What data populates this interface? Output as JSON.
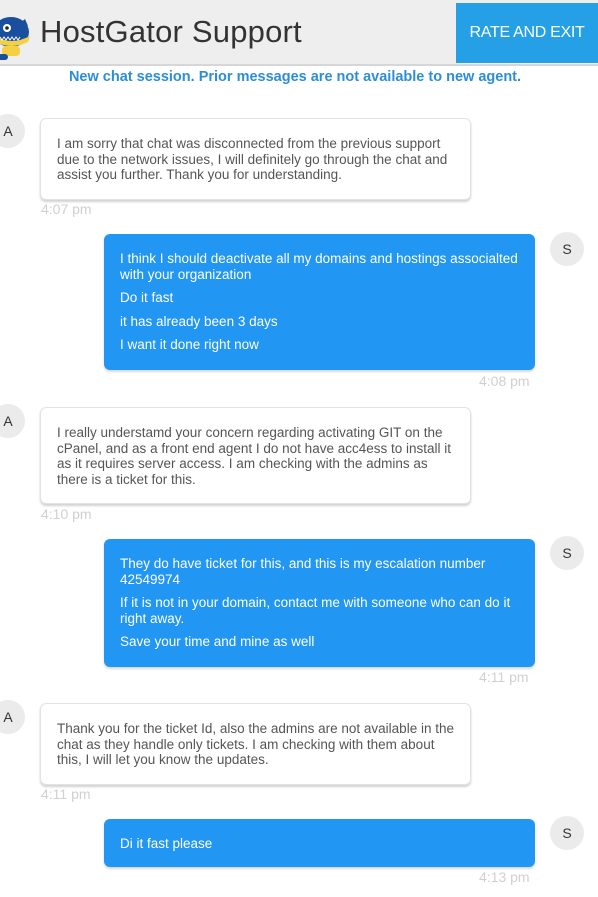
{
  "header": {
    "title": "HostGator Support",
    "rate_exit_label": "RATE AND EXIT"
  },
  "notice": "New chat session. Prior messages are not available to new agent.",
  "colors": {
    "header_bg": "#eeeeee",
    "button_bg": "#25a0e6",
    "notice_text": "#2d8ed6",
    "user_bubble": "#2196f3",
    "agent_bubble": "#ffffff",
    "timestamp": "#d0d0d0"
  },
  "messages": [
    {
      "sender": "agent",
      "avatar": "A",
      "lines": [
        "I am sorry that chat was disconnected from the previous support due to the network issues, I will definitely go through the chat and assist you further. Thank you for understanding."
      ],
      "time": "4:07 pm"
    },
    {
      "sender": "user",
      "avatar": "S",
      "lines": [
        "I think I should deactivate all my domains and hostings associalted with your organization",
        "Do it fast",
        "it has already been 3 days",
        "I want it done right now"
      ],
      "time": "4:08 pm"
    },
    {
      "sender": "agent",
      "avatar": "A",
      "lines": [
        "I really understamd your concern regarding activating GIT on the cPanel, and as a front end agent I do not have acc4ess to install it as it requires server access. I am checking with the admins as there is a ticket for this."
      ],
      "time": "4:10 pm"
    },
    {
      "sender": "user",
      "avatar": "S",
      "lines": [
        "They do have ticket for this, and this is my escalation number 42549974",
        "If it is not in your domain, contact me with someone who can do it right away.",
        "Save your time and mine as well"
      ],
      "time": "4:11 pm"
    },
    {
      "sender": "agent",
      "avatar": "A",
      "lines": [
        "Thank you for the ticket Id, also the admins are not available in the chat as they handle only tickets. I am checking with them about this, I will let you know the updates."
      ],
      "time": "4:11 pm"
    },
    {
      "sender": "user",
      "avatar": "S",
      "lines": [
        "Di it fast please"
      ],
      "time": "4:13 pm"
    }
  ]
}
